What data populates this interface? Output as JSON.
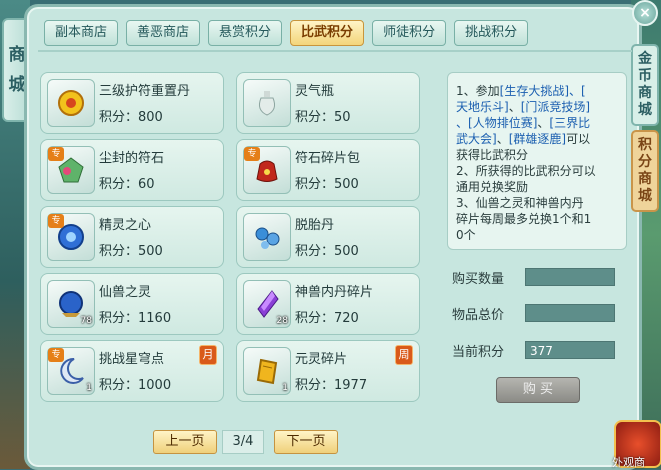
{
  "left_tab": {
    "chars": [
      "商",
      "城"
    ]
  },
  "right_tabs": [
    {
      "chars": [
        "金",
        "币",
        "商",
        "城"
      ]
    },
    {
      "chars": [
        "积",
        "分",
        "商",
        "城"
      ]
    }
  ],
  "close_label": "×",
  "tabs": [
    {
      "label": "副本商店",
      "active": false
    },
    {
      "label": "善恶商店",
      "active": false
    },
    {
      "label": "悬赏积分",
      "active": false
    },
    {
      "label": "比武积分",
      "active": true
    },
    {
      "label": "师徒积分",
      "active": false
    },
    {
      "label": "挑战积分",
      "active": false
    }
  ],
  "items": [
    {
      "name": "三级护符重置丹",
      "points": "积分：800",
      "exclusive": false,
      "qty": "",
      "period": ""
    },
    {
      "name": "灵气瓶",
      "points": "积分：50",
      "exclusive": false,
      "qty": "",
      "period": ""
    },
    {
      "name": "尘封的符石",
      "points": "积分：60",
      "exclusive": true,
      "qty": "",
      "period": ""
    },
    {
      "name": "符石碎片包",
      "points": "积分：500",
      "exclusive": true,
      "qty": "",
      "period": ""
    },
    {
      "name": "精灵之心",
      "points": "积分：500",
      "exclusive": true,
      "qty": "",
      "period": ""
    },
    {
      "name": "脱胎丹",
      "points": "积分：500",
      "exclusive": false,
      "qty": "",
      "period": ""
    },
    {
      "name": "仙兽之灵",
      "points": "积分：1160",
      "exclusive": false,
      "qty": "78",
      "period": ""
    },
    {
      "name": "神兽内丹碎片",
      "points": "积分：720",
      "exclusive": false,
      "qty": "28",
      "period": ""
    },
    {
      "name": "挑战星穹点",
      "points": "积分：1000",
      "exclusive": true,
      "qty": "1",
      "period": "月"
    },
    {
      "name": "元灵碎片",
      "points": "积分：1977",
      "exclusive": false,
      "qty": "1",
      "period": "周"
    }
  ],
  "exclusive_badge": "专",
  "info": {
    "l1a": "1、参加",
    "l1b": "[生存大挑战]",
    "l1c": "、[",
    "l2a": "天地乐斗]",
    "l2b": "、",
    "l2c": "[门派竞技场]",
    "l3a": "、",
    "l3b": "[人物排位赛]",
    "l3c": "、",
    "l3d": "[三界比",
    "l4a": "武大会]",
    "l4b": "、",
    "l4c": "[群雄逐鹿]",
    "l4d": "可以",
    "l5": "获得比武积分",
    "l6": "2、所获得的比武积分可以",
    "l7": "通用兑换奖励",
    "l8": "3、仙兽之灵和神兽内丹",
    "l9": "碎片每周最多兑换1个和1",
    "l10": "0个"
  },
  "purchase": {
    "qty_label": "购买数量",
    "qty_value": "",
    "total_label": "物品总价",
    "total_value": "",
    "current_label": "当前积分",
    "current_value": "377",
    "buy_label": "购 买"
  },
  "pager": {
    "prev": "上一页",
    "page": "3/4",
    "next": "下一页"
  },
  "corner_label": "外观商"
}
